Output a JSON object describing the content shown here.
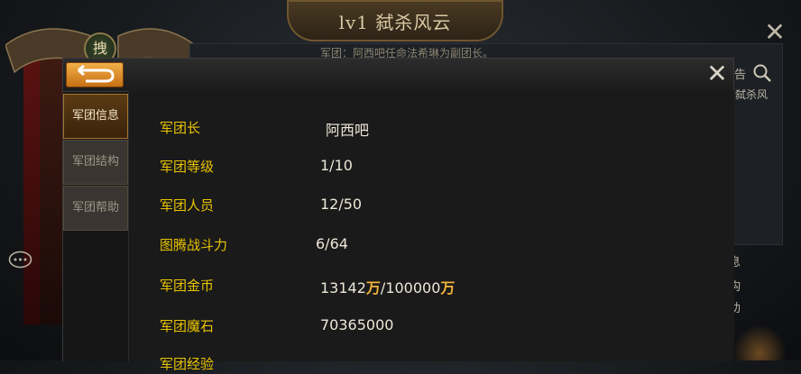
{
  "background": {
    "title": "lv1 弑杀风云",
    "notice": "军团：阿西吧任命法希琳为副团长。",
    "emblem_seal": "拽",
    "search_label": "告",
    "search_sub": "弑杀风",
    "side_labels": [
      "息",
      "构",
      "助"
    ]
  },
  "dialog": {
    "tabs": [
      {
        "label": "军团信息",
        "active": true
      },
      {
        "label": "军团结构",
        "active": false
      },
      {
        "label": "军团帮助",
        "active": false
      }
    ],
    "rows": [
      {
        "label": "军团长",
        "value": "阿西吧"
      },
      {
        "label": "军团等级",
        "value": "1/10"
      },
      {
        "label": "军团人员",
        "value": "12/50"
      },
      {
        "label": "图腾战斗力",
        "value": "6/64"
      },
      {
        "label": "军团金币",
        "value_a": "13142",
        "unit_a": "万",
        "value_b": "/100000",
        "unit_b": "万"
      },
      {
        "label": "军团魔石",
        "value": "70365000"
      },
      {
        "label": "军团经验",
        "value": ""
      }
    ]
  },
  "colors": {
    "label": "#e9c400",
    "value": "#ede7d8",
    "back_button": "#e39a30",
    "active_tab": "#5b3b14"
  },
  "icons": {
    "back": "return-arrow-icon",
    "close": "close-x-icon",
    "search": "magnifier-icon",
    "chat": "chat-bubble-icon"
  }
}
